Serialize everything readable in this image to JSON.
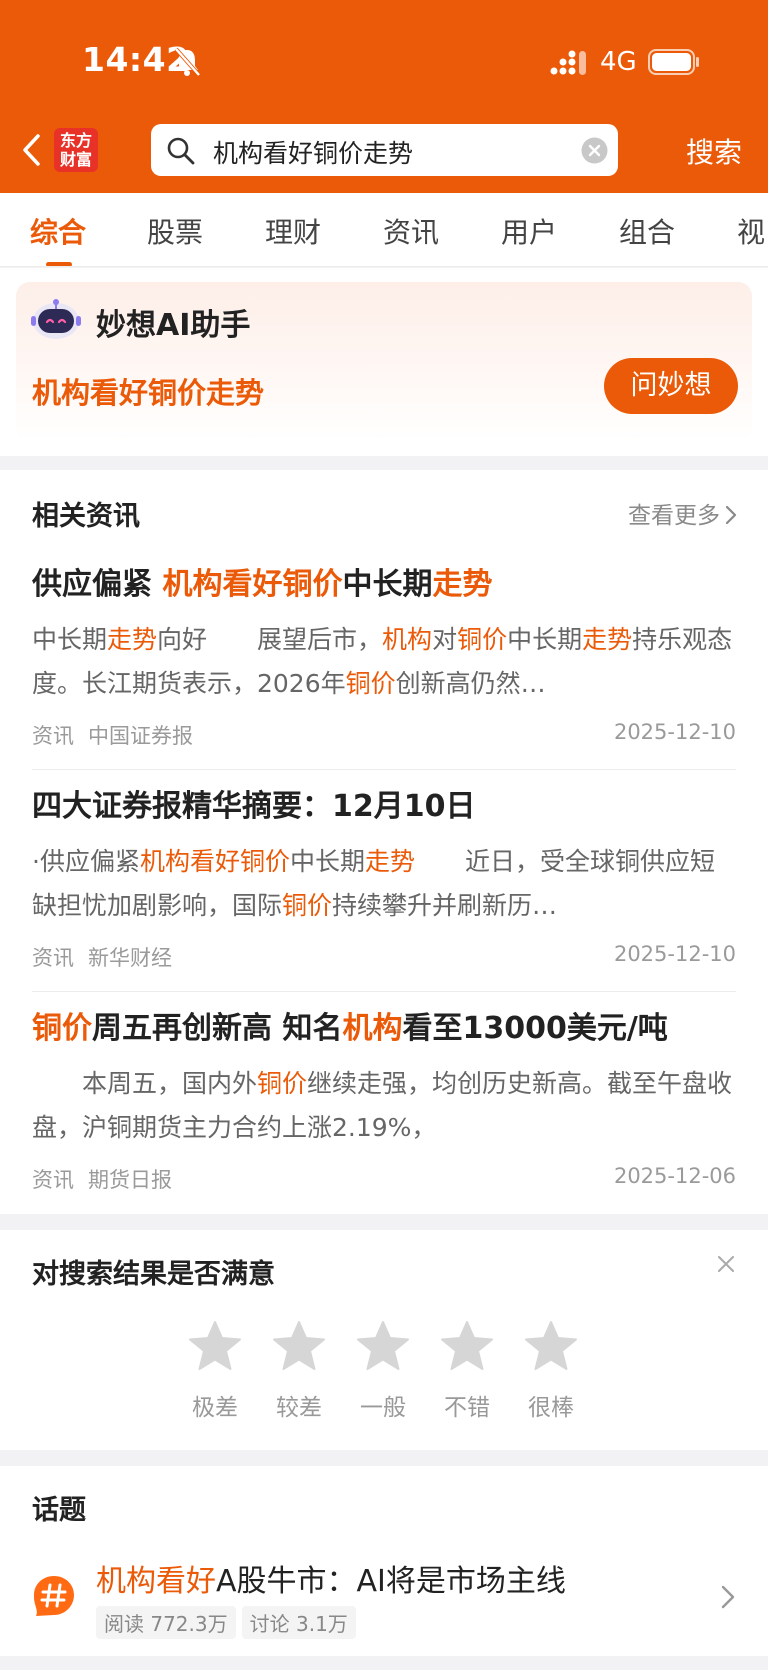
{
  "status_bar": {
    "time": "14:42",
    "network": "4G"
  },
  "header": {
    "logo_line1": "东方",
    "logo_line2": "财富",
    "search_query": "机构看好铜价走势",
    "search_button": "搜索"
  },
  "tabs": [
    "综合",
    "股票",
    "理财",
    "资讯",
    "用户",
    "组合",
    "视"
  ],
  "ai_card": {
    "title": "妙想AI助手",
    "query": "机构看好铜价走势",
    "ask_button": "问妙想"
  },
  "news": {
    "section_title": "相关资讯",
    "more_label": "查看更多",
    "items": [
      {
        "title": [
          {
            "t": "供应偏紧 ",
            "h": false
          },
          {
            "t": "机构看好铜价",
            "h": true
          },
          {
            "t": "中长期",
            "h": false
          },
          {
            "t": "走势",
            "h": true
          }
        ],
        "summary": [
          {
            "t": "中长期",
            "h": false
          },
          {
            "t": "走势",
            "h": true
          },
          {
            "t": "向好　　展望后市，",
            "h": false
          },
          {
            "t": "机构",
            "h": true
          },
          {
            "t": "对",
            "h": false
          },
          {
            "t": "铜价",
            "h": true
          },
          {
            "t": "中长期",
            "h": false
          },
          {
            "t": "走势",
            "h": true
          },
          {
            "t": "持乐观态度。长江期货表示，2026年",
            "h": false
          },
          {
            "t": "铜价",
            "h": true
          },
          {
            "t": "创新高仍然…",
            "h": false
          }
        ],
        "category": "资讯",
        "source": "中国证券报",
        "date": "2025-12-10"
      },
      {
        "title": [
          {
            "t": "四大证券报精华摘要：12月10日",
            "h": false
          }
        ],
        "summary": [
          {
            "t": "·供应偏紧",
            "h": false
          },
          {
            "t": "机构看好铜价",
            "h": true
          },
          {
            "t": "中长期",
            "h": false
          },
          {
            "t": "走势",
            "h": true
          },
          {
            "t": "　　近日，受全球铜供应短缺担忧加剧影响，国际",
            "h": false
          },
          {
            "t": "铜价",
            "h": true
          },
          {
            "t": "持续攀升并刷新历…",
            "h": false
          }
        ],
        "category": "资讯",
        "source": "新华财经",
        "date": "2025-12-10"
      },
      {
        "title": [
          {
            "t": "铜价",
            "h": true
          },
          {
            "t": "周五再创新高 知名",
            "h": false
          },
          {
            "t": "机构",
            "h": true
          },
          {
            "t": "看至13000美元/吨",
            "h": false
          }
        ],
        "summary": [
          {
            "t": "　　本周五，国内外",
            "h": false
          },
          {
            "t": "铜价",
            "h": true
          },
          {
            "t": "继续走强，均创历史新高。截至午盘收盘，沪铜期货主力合约上涨2.19%，",
            "h": false
          }
        ],
        "category": "资讯",
        "source": "期货日报",
        "date": "2025-12-06"
      }
    ]
  },
  "feedback": {
    "title": "对搜索结果是否满意",
    "ratings": [
      "极差",
      "较差",
      "一般",
      "不错",
      "很棒"
    ]
  },
  "topics": {
    "section_title": "话题",
    "item": {
      "title_highlight": "机构看好",
      "title_rest": "A股牛市：AI将是市场主线",
      "reads": "阅读 772.3万",
      "discussions": "讨论 3.1万"
    }
  },
  "colors": {
    "accent": "#eb5a08",
    "logo_red": "#e83228"
  }
}
